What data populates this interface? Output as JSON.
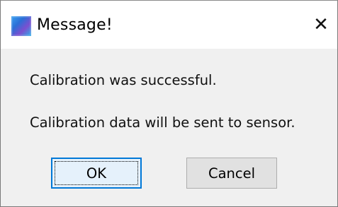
{
  "window": {
    "title": "Message!",
    "close_glyph": "✕",
    "icon": "app-icon"
  },
  "message": {
    "line1": "Calibration was successful.",
    "line2": "Calibration data will be sent to sensor."
  },
  "buttons": {
    "ok_label": "OK",
    "cancel_label": "Cancel"
  },
  "colors": {
    "focus_border": "#0078d7",
    "dialog_bg": "#f0f0f0"
  }
}
